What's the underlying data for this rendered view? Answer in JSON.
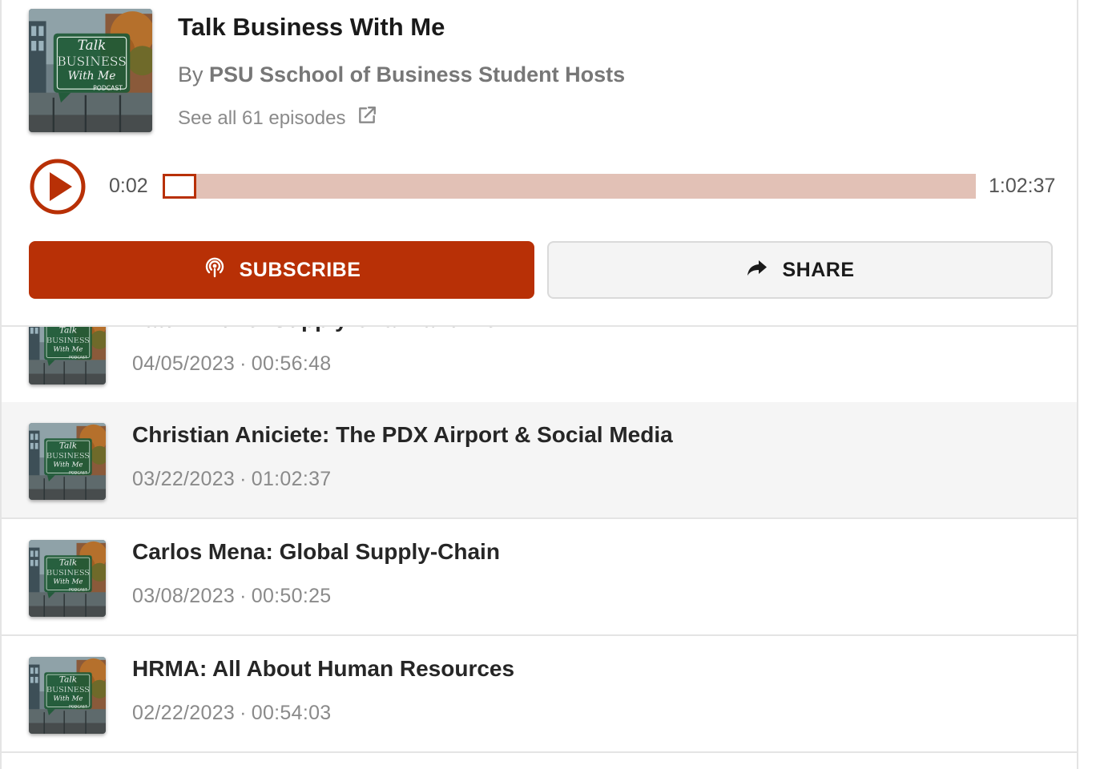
{
  "podcast": {
    "title": "Talk Business With Me",
    "by_prefix": "By",
    "host": "PSU Sschool of Business Student Hosts",
    "see_all": "See all 61 episodes",
    "cover": {
      "line1": "Talk",
      "line2": "BUSINESS",
      "line3": "With Me",
      "line4": "PODCAST"
    }
  },
  "player": {
    "current_time": "0:02",
    "total_time": "1:02:37",
    "progress_fraction": 0.0005,
    "accent_color": "#b83006",
    "track_color": "#e2c1b6"
  },
  "actions": {
    "subscribe_label": "SUBSCRIBE",
    "subscribe_icon": "podcast-icon",
    "share_label": "SHARE",
    "share_icon": "share-arrow-icon"
  },
  "episodes": [
    {
      "title": "Tatum Duke: Supply Chain and Be",
      "date": "04/05/2023",
      "duration": "00:56:48",
      "active": false
    },
    {
      "title": "Christian Aniciete: The PDX Airport & Social Media",
      "date": "03/22/2023",
      "duration": "01:02:37",
      "active": true
    },
    {
      "title": "Carlos Mena: Global Supply-Chain",
      "date": "03/08/2023",
      "duration": "00:50:25",
      "active": false
    },
    {
      "title": "HRMA: All About Human Resources",
      "date": "02/22/2023",
      "duration": "00:54:03",
      "active": false
    }
  ],
  "meta_separator": "·"
}
